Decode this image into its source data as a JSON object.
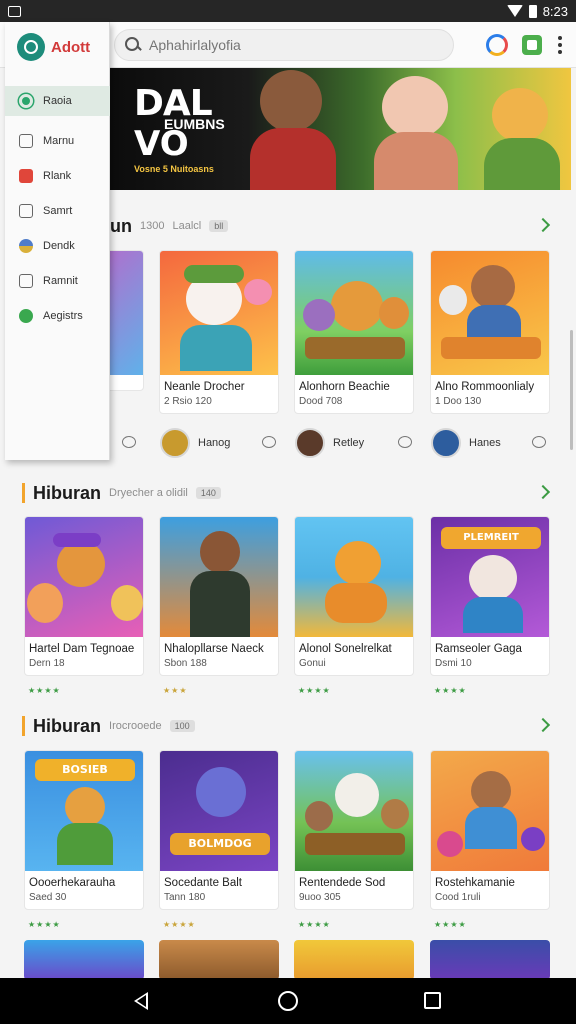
{
  "status_bar": {
    "time": "8:23"
  },
  "search": {
    "placeholder": "Aphahirlalyofia"
  },
  "banner": {
    "title": "DAL",
    "subtitle": "EUMBNS",
    "vo": "VO",
    "tagline": "Vosne 5 Nuitoasns"
  },
  "drawer": {
    "brand": "Adott",
    "items": [
      {
        "label": "Raoia",
        "icon": "home-icon",
        "color": "#2ba56c"
      },
      {
        "label": "Marnu",
        "icon": "bell-icon",
        "color": "#8a8a8a"
      },
      {
        "label": "Rlank",
        "icon": "gift-icon",
        "color": "#e0463a"
      },
      {
        "label": "Samrt",
        "icon": "tv-icon",
        "color": "#8a8a8a"
      },
      {
        "label": "Dendk",
        "icon": "globe-icon",
        "color": "#4f7cc9"
      },
      {
        "label": "Ramnit",
        "icon": "calendar-icon",
        "color": "#8a8a8a"
      },
      {
        "label": "Aegistrs",
        "icon": "leaf-icon",
        "color": "#3aa84f"
      }
    ]
  },
  "section1": {
    "title": "un",
    "meta": "1300",
    "tag1": "Laalcl",
    "tag2": "bll",
    "cards": [
      {
        "title": "",
        "sub": ""
      },
      {
        "title": "Neanle Drocher",
        "sub": "2 Rsio 120"
      },
      {
        "title": "Alonhorn Beachie",
        "sub": "Dood 708"
      },
      {
        "title": "Alno Rommoonlialy",
        "sub": "1 Doo 130"
      }
    ],
    "authors": [
      {
        "name": "Hanog"
      },
      {
        "name": "Retley"
      },
      {
        "name": "Hanes"
      }
    ]
  },
  "section2": {
    "title": "Hiburan",
    "meta": "Dryecher a olidil",
    "tag": "140",
    "cards": [
      {
        "title": "Hartel Dam Tegnoae",
        "sub": "Dern 18",
        "art": "BLUE",
        "stars": "★★★★"
      },
      {
        "title": "Nhalopllarse Naeck",
        "sub": "Sbon 188",
        "art": "",
        "stars": "★★★"
      },
      {
        "title": "Alonol Sonelrelkat",
        "sub": "Gonui",
        "art": "",
        "stars": "★★★★"
      },
      {
        "title": "Ramseoler Gaga",
        "sub": "Dsmi 10",
        "art": "PLEMREIT",
        "stars": "★★★★"
      }
    ]
  },
  "section3": {
    "title": "Hiburan",
    "meta": "Irocrooede",
    "tag": "100",
    "cards": [
      {
        "title": "Oooerhekarauha",
        "sub": "Saed 30",
        "art": "BOSIEB",
        "stars": "★★★★"
      },
      {
        "title": "Socedante Balt",
        "sub": "Tann 180",
        "art": "BOLMDOG",
        "stars": "★★★★"
      },
      {
        "title": "Rentendede Sod",
        "sub": "9uoo 305",
        "art": "",
        "stars": "★★★★"
      },
      {
        "title": "Rostehkamanie",
        "sub": "Cood 1ruli",
        "art": "",
        "stars": "★★★★"
      }
    ]
  },
  "colors": {
    "accent": "#3c9b43",
    "section_bar": "#f2a42c",
    "brand": "#d23a3a"
  }
}
